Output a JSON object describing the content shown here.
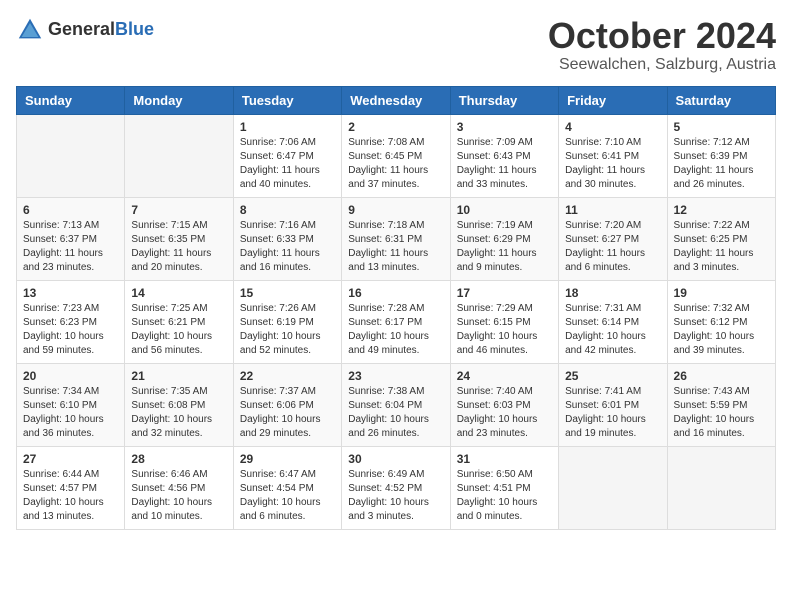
{
  "header": {
    "logo_general": "General",
    "logo_blue": "Blue",
    "month_title": "October 2024",
    "location": "Seewalchen, Salzburg, Austria"
  },
  "days_of_week": [
    "Sunday",
    "Monday",
    "Tuesday",
    "Wednesday",
    "Thursday",
    "Friday",
    "Saturday"
  ],
  "weeks": [
    [
      {
        "day": "",
        "info": ""
      },
      {
        "day": "",
        "info": ""
      },
      {
        "day": "1",
        "info": "Sunrise: 7:06 AM\nSunset: 6:47 PM\nDaylight: 11 hours and 40 minutes."
      },
      {
        "day": "2",
        "info": "Sunrise: 7:08 AM\nSunset: 6:45 PM\nDaylight: 11 hours and 37 minutes."
      },
      {
        "day": "3",
        "info": "Sunrise: 7:09 AM\nSunset: 6:43 PM\nDaylight: 11 hours and 33 minutes."
      },
      {
        "day": "4",
        "info": "Sunrise: 7:10 AM\nSunset: 6:41 PM\nDaylight: 11 hours and 30 minutes."
      },
      {
        "day": "5",
        "info": "Sunrise: 7:12 AM\nSunset: 6:39 PM\nDaylight: 11 hours and 26 minutes."
      }
    ],
    [
      {
        "day": "6",
        "info": "Sunrise: 7:13 AM\nSunset: 6:37 PM\nDaylight: 11 hours and 23 minutes."
      },
      {
        "day": "7",
        "info": "Sunrise: 7:15 AM\nSunset: 6:35 PM\nDaylight: 11 hours and 20 minutes."
      },
      {
        "day": "8",
        "info": "Sunrise: 7:16 AM\nSunset: 6:33 PM\nDaylight: 11 hours and 16 minutes."
      },
      {
        "day": "9",
        "info": "Sunrise: 7:18 AM\nSunset: 6:31 PM\nDaylight: 11 hours and 13 minutes."
      },
      {
        "day": "10",
        "info": "Sunrise: 7:19 AM\nSunset: 6:29 PM\nDaylight: 11 hours and 9 minutes."
      },
      {
        "day": "11",
        "info": "Sunrise: 7:20 AM\nSunset: 6:27 PM\nDaylight: 11 hours and 6 minutes."
      },
      {
        "day": "12",
        "info": "Sunrise: 7:22 AM\nSunset: 6:25 PM\nDaylight: 11 hours and 3 minutes."
      }
    ],
    [
      {
        "day": "13",
        "info": "Sunrise: 7:23 AM\nSunset: 6:23 PM\nDaylight: 10 hours and 59 minutes."
      },
      {
        "day": "14",
        "info": "Sunrise: 7:25 AM\nSunset: 6:21 PM\nDaylight: 10 hours and 56 minutes."
      },
      {
        "day": "15",
        "info": "Sunrise: 7:26 AM\nSunset: 6:19 PM\nDaylight: 10 hours and 52 minutes."
      },
      {
        "day": "16",
        "info": "Sunrise: 7:28 AM\nSunset: 6:17 PM\nDaylight: 10 hours and 49 minutes."
      },
      {
        "day": "17",
        "info": "Sunrise: 7:29 AM\nSunset: 6:15 PM\nDaylight: 10 hours and 46 minutes."
      },
      {
        "day": "18",
        "info": "Sunrise: 7:31 AM\nSunset: 6:14 PM\nDaylight: 10 hours and 42 minutes."
      },
      {
        "day": "19",
        "info": "Sunrise: 7:32 AM\nSunset: 6:12 PM\nDaylight: 10 hours and 39 minutes."
      }
    ],
    [
      {
        "day": "20",
        "info": "Sunrise: 7:34 AM\nSunset: 6:10 PM\nDaylight: 10 hours and 36 minutes."
      },
      {
        "day": "21",
        "info": "Sunrise: 7:35 AM\nSunset: 6:08 PM\nDaylight: 10 hours and 32 minutes."
      },
      {
        "day": "22",
        "info": "Sunrise: 7:37 AM\nSunset: 6:06 PM\nDaylight: 10 hours and 29 minutes."
      },
      {
        "day": "23",
        "info": "Sunrise: 7:38 AM\nSunset: 6:04 PM\nDaylight: 10 hours and 26 minutes."
      },
      {
        "day": "24",
        "info": "Sunrise: 7:40 AM\nSunset: 6:03 PM\nDaylight: 10 hours and 23 minutes."
      },
      {
        "day": "25",
        "info": "Sunrise: 7:41 AM\nSunset: 6:01 PM\nDaylight: 10 hours and 19 minutes."
      },
      {
        "day": "26",
        "info": "Sunrise: 7:43 AM\nSunset: 5:59 PM\nDaylight: 10 hours and 16 minutes."
      }
    ],
    [
      {
        "day": "27",
        "info": "Sunrise: 6:44 AM\nSunset: 4:57 PM\nDaylight: 10 hours and 13 minutes."
      },
      {
        "day": "28",
        "info": "Sunrise: 6:46 AM\nSunset: 4:56 PM\nDaylight: 10 hours and 10 minutes."
      },
      {
        "day": "29",
        "info": "Sunrise: 6:47 AM\nSunset: 4:54 PM\nDaylight: 10 hours and 6 minutes."
      },
      {
        "day": "30",
        "info": "Sunrise: 6:49 AM\nSunset: 4:52 PM\nDaylight: 10 hours and 3 minutes."
      },
      {
        "day": "31",
        "info": "Sunrise: 6:50 AM\nSunset: 4:51 PM\nDaylight: 10 hours and 0 minutes."
      },
      {
        "day": "",
        "info": ""
      },
      {
        "day": "",
        "info": ""
      }
    ]
  ]
}
